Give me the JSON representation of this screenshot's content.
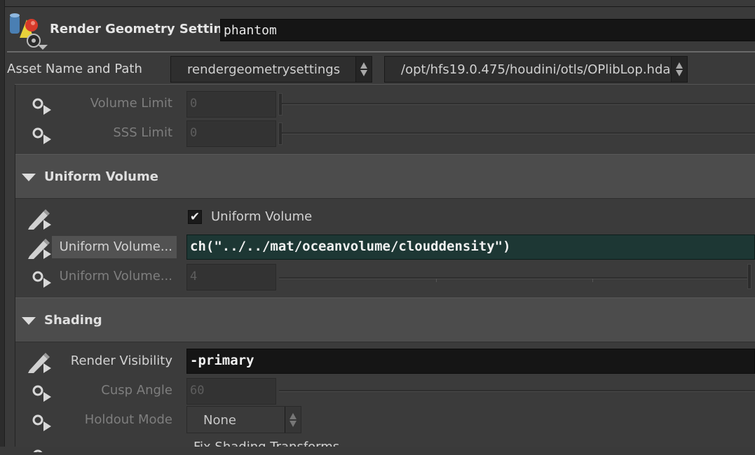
{
  "header": {
    "node_type": "Render Geometry Settings",
    "node_name": "phantom"
  },
  "asset": {
    "label": "Asset Name and Path",
    "name_value": "rendergeometrysettings",
    "path_value": "/opt/hfs19.0.475/houdini/otls/OPlibLop.hda"
  },
  "limits": {
    "volume_limit": {
      "label": "Volume Limit",
      "value": "0"
    },
    "sss_limit": {
      "label": "SSS Limit",
      "value": "0"
    }
  },
  "uniform_volume_section": {
    "title": "Uniform Volume",
    "checkbox_label": "Uniform Volume",
    "checkbox_checked": true,
    "density": {
      "label": "Uniform Volume...",
      "value": "ch(\"../../mat/oceanvolume/clouddensity\")"
    },
    "samples": {
      "label": "Uniform Volume...",
      "value": "4"
    }
  },
  "shading_section": {
    "title": "Shading",
    "render_visibility": {
      "label": "Render Visibility",
      "value": "-primary"
    },
    "cusp_angle": {
      "label": "Cusp Angle",
      "value": "60"
    },
    "holdout_mode": {
      "label": "Holdout Mode",
      "value": "None"
    },
    "partial_next": "Fix Shading Transforms"
  },
  "icons": {
    "header": "render-geometry-settings-icon",
    "pin": "pin-icon",
    "edit": "pencil-icon"
  },
  "colors": {
    "background": "#3a3a3a",
    "section_header": "#4c4c4c",
    "text_field": "#151515",
    "expression_field": "#1d3734"
  }
}
